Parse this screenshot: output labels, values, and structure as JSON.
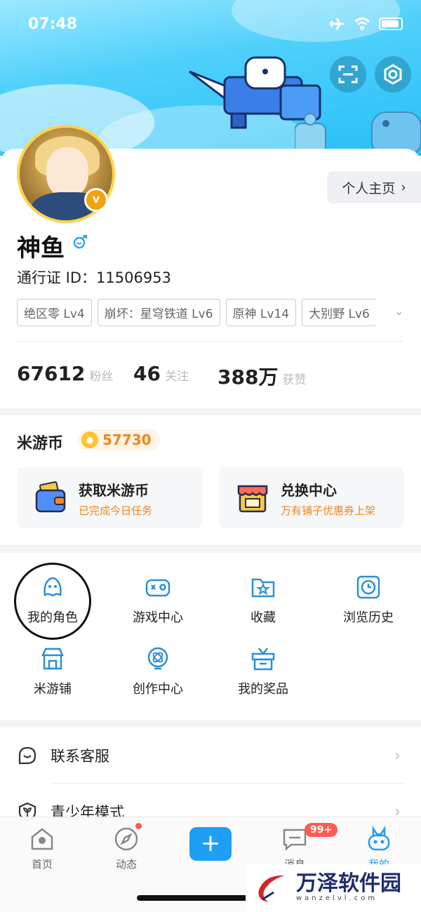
{
  "status_bar": {
    "time": "07:48"
  },
  "profile": {
    "home_button": "个人主页",
    "nickname": "神鱼",
    "verified_badge": "v",
    "pass_id_label": "通行证 ID：",
    "pass_id": "11506953",
    "game_tags": [
      "绝区零 Lv4",
      "崩坏：星穹铁道 Lv6",
      "原神 Lv14",
      "大别野 Lv6"
    ],
    "stats": [
      {
        "value": "67612",
        "label": "粉丝"
      },
      {
        "value": "46",
        "label": "关注"
      },
      {
        "value": "388万",
        "label": "获赞"
      }
    ]
  },
  "coins": {
    "title": "米游币",
    "balance": "57730",
    "cards": [
      {
        "title": "获取米游币",
        "subtitle": "已完成今日任务",
        "icon": "wallet-icon"
      },
      {
        "title": "兑换中心",
        "subtitle": "万有铺子优惠券上架",
        "icon": "shop-icon"
      }
    ]
  },
  "grid_menu": [
    {
      "label": "我的角色",
      "icon": "character-icon"
    },
    {
      "label": "游戏中心",
      "icon": "gamepad-icon"
    },
    {
      "label": "收藏",
      "icon": "star-folder-icon"
    },
    {
      "label": "浏览历史",
      "icon": "clock-icon"
    },
    {
      "label": "米游铺",
      "icon": "store-icon"
    },
    {
      "label": "创作中心",
      "icon": "creator-icon"
    },
    {
      "label": "我的奖品",
      "icon": "gift-icon"
    }
  ],
  "list_menu": [
    {
      "label": "联系客服",
      "icon": "chat-smile-icon"
    },
    {
      "label": "青少年模式",
      "icon": "leaf-shield-icon"
    }
  ],
  "tab_bar": {
    "tabs": [
      {
        "label": "首页",
        "icon": "home-icon"
      },
      {
        "label": "动态",
        "icon": "compass-icon"
      },
      {
        "label": "",
        "icon": "plus-icon"
      },
      {
        "label": "消息",
        "icon": "message-icon",
        "badge": "99+"
      },
      {
        "label": "我的",
        "icon": "bunny-icon"
      }
    ]
  },
  "watermark": {
    "title": "万泽软件园",
    "url": "wanzelvl.com"
  },
  "colors": {
    "accent": "#1e9ef5",
    "coin_orange": "#f2871a",
    "badge_red": "#ff5a4f"
  }
}
